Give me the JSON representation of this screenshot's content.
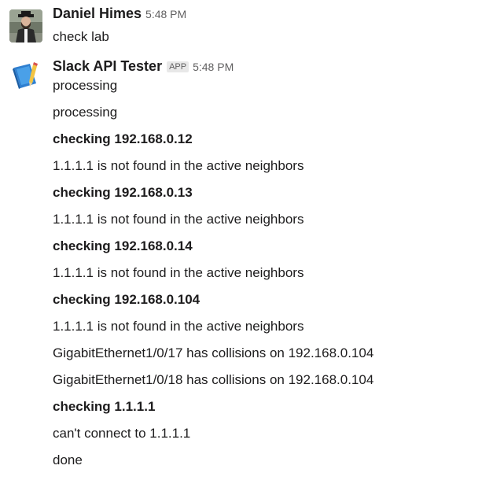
{
  "messages": [
    {
      "sender": "Daniel Himes",
      "time": "5:48 PM",
      "avatar_icon": "user-photo-avatar",
      "lines": [
        {
          "text": "check lab",
          "bold": false
        }
      ]
    },
    {
      "sender": "Slack API Tester",
      "badge": "APP",
      "time": "5:48 PM",
      "avatar_icon": "blue-book-pencil-avatar",
      "lines": [
        {
          "text": "processing",
          "bold": false
        },
        {
          "text": "processing",
          "bold": false
        },
        {
          "text": "checking 192.168.0.12",
          "bold": true
        },
        {
          "text": "1.1.1.1 is not found in the active neighbors",
          "bold": false
        },
        {
          "text": "checking 192.168.0.13",
          "bold": true
        },
        {
          "text": "1.1.1.1 is not found in the active neighbors",
          "bold": false
        },
        {
          "text": "checking 192.168.0.14",
          "bold": true
        },
        {
          "text": "1.1.1.1 is not found in the active neighbors",
          "bold": false
        },
        {
          "text": "checking 192.168.0.104",
          "bold": true
        },
        {
          "text": "1.1.1.1 is not found in the active neighbors",
          "bold": false
        },
        {
          "text": "GigabitEthernet1/0/17 has collisions on 192.168.0.104",
          "bold": false
        },
        {
          "text": "GigabitEthernet1/0/18 has collisions on 192.168.0.104",
          "bold": false
        },
        {
          "text": "checking 1.1.1.1",
          "bold": true
        },
        {
          "text": "can't connect to 1.1.1.1",
          "bold": false
        },
        {
          "text": "done",
          "bold": false
        }
      ]
    }
  ]
}
